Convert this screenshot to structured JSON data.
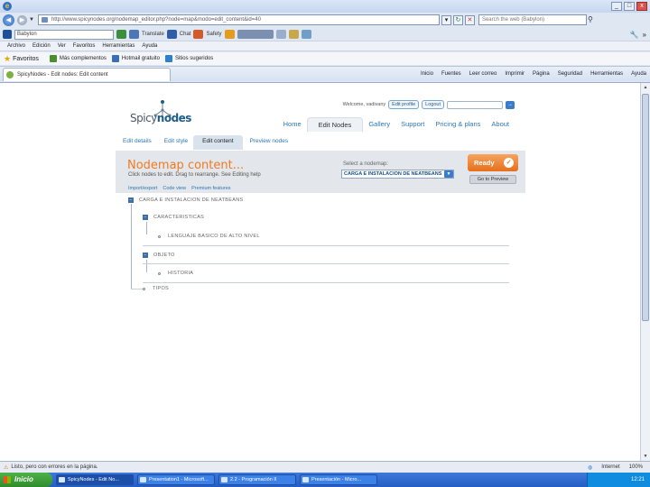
{
  "browser": {
    "logo_glyph": "e",
    "url": "http://www.spicynodes.org/nodemap_editor.php?node=map&modo=edit_content&id=40",
    "search_placeholder": "Search the web (Babylon)",
    "window_buttons": [
      "_",
      "□",
      "x"
    ],
    "toolbar_search_value": "Babylon",
    "toolbar_items": [
      "Translate",
      "Chat",
      "Safety"
    ],
    "menu": [
      "Archivo",
      "Edición",
      "Ver",
      "Favoritos",
      "Herramientas",
      "Ayuda"
    ],
    "favorites_label": "Favoritos",
    "favorites_links": [
      "Más complementos",
      "Hotmail gratuito",
      "Sitios sugeridos"
    ],
    "tab_title": "SpicyNodes - Edit nodes: Edit content",
    "commands": [
      "Inicio",
      "Fuentes",
      "Leer correo",
      "Imprimir",
      "Página",
      "Seguridad",
      "Herramientas",
      "Ayuda"
    ]
  },
  "site": {
    "logo": {
      "part1": "Spicy",
      "part2": "nodes"
    },
    "user": {
      "welcome": "Welcome, vadivany",
      "edit_profile": "Edit profile",
      "logout": "Logout",
      "go": "→"
    },
    "main_nav": [
      "Home",
      "Edit Nodes",
      "Gallery",
      "Support",
      "Pricing & plans",
      "About"
    ],
    "active_main_nav": "Edit Nodes",
    "sub_nav": [
      "Edit details",
      "Edit style",
      "Edit content",
      "Preview nodes"
    ],
    "active_sub_nav": "Edit content",
    "header": {
      "title": "Nodemap content...",
      "subtitle": "Click nodes to edit. Drag to rearrange. See Editing help",
      "select_label": "Select a nodemap:",
      "select_value": "CARGA E INSTALACION DE NEATBEANS",
      "ready_label": "Ready",
      "preview_label": "Go to Preview",
      "tools": [
        "Import/export",
        "Code view",
        "Premium features"
      ]
    },
    "tree": [
      {
        "label": "CARGA E INSTALACION DE NEATBEANS",
        "level": 0,
        "expanded": true
      },
      {
        "label": "CARACTERISTICAS",
        "level": 1,
        "expanded": true
      },
      {
        "label": "LENGUAJE BASICO DE ALTO NIVEL",
        "level": 2
      },
      {
        "label": "OBJETO",
        "level": 1,
        "expanded": true
      },
      {
        "label": "HISTORIA",
        "level": 2
      },
      {
        "label": "TIPOS",
        "level": 1
      }
    ]
  },
  "status": {
    "text": "Listo, pero con errores en la página.",
    "zone": "Internet",
    "zoom": "100%"
  },
  "taskbar": {
    "start": "Inicio",
    "tasks": [
      "SpicyNodes - Edit No...",
      "Presentation1 - Microsoft...",
      "2.2 - Programación II",
      "Presentación - Micro..."
    ],
    "clock": "12:21"
  }
}
